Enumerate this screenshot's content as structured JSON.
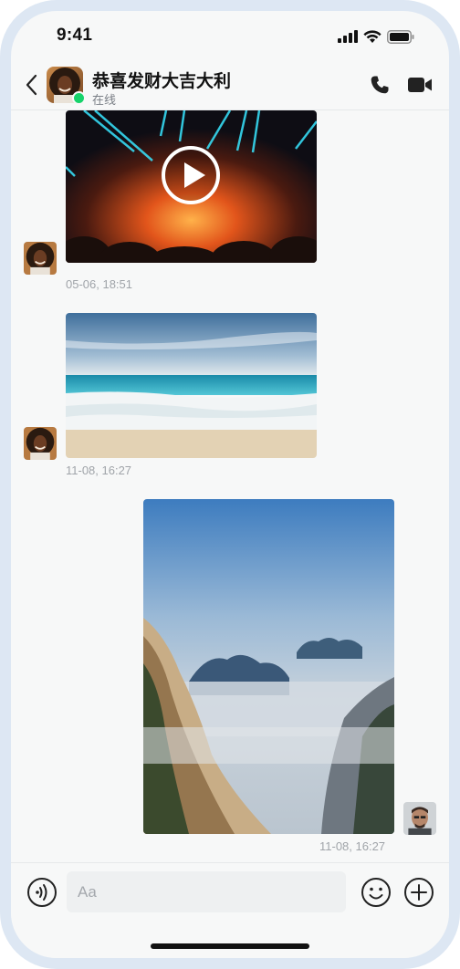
{
  "status_bar": {
    "time": "9:41"
  },
  "header": {
    "name": "恭喜发财大吉大利",
    "status": "在线"
  },
  "messages": [
    {
      "type": "video",
      "sender": "contact",
      "timestamp": "05-06, 18:51"
    },
    {
      "type": "image",
      "sender": "contact",
      "timestamp": "11-08, 16:27"
    },
    {
      "type": "image",
      "sender": "me",
      "timestamp": "11-08, 16:27"
    }
  ],
  "composer": {
    "placeholder": "Aa"
  },
  "colors": {
    "online": "#16d36b",
    "background": "#f7f8f8",
    "frame": "#dde7f3"
  }
}
